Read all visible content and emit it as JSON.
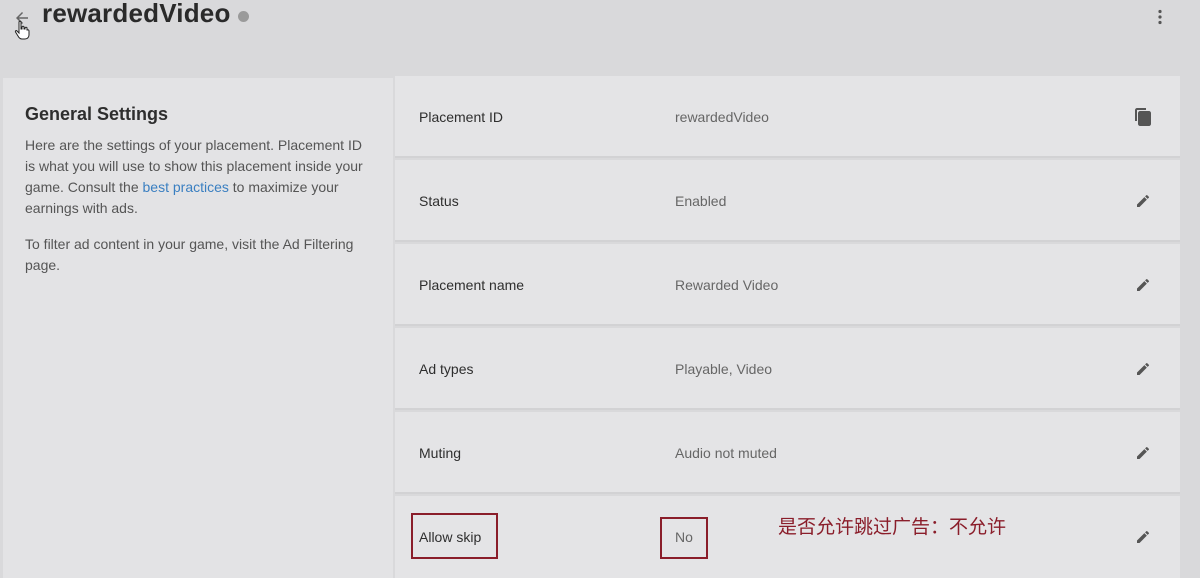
{
  "header": {
    "title": "rewardedVideo",
    "back_icon": "arrow-left-icon",
    "more_icon": "more-vertical-icon",
    "status_color": "#9a9a9a"
  },
  "general": {
    "title": "General Settings",
    "desc_part1": "Here are the settings of your placement. Placement ID is what you will use to show this placement inside your game. Consult the ",
    "desc_link": "best practices",
    "desc_part2": " to maximize your earnings with ads.",
    "filter_text": "To filter ad content in your game, visit the Ad Filtering page."
  },
  "settings": [
    {
      "label": "Placement ID",
      "value": "rewardedVideo",
      "action": "copy-icon"
    },
    {
      "label": "Status",
      "value": "Enabled",
      "action": "edit-icon"
    },
    {
      "label": "Placement name",
      "value": "Rewarded Video",
      "action": "edit-icon"
    },
    {
      "label": "Ad types",
      "value": "Playable, Video",
      "action": "edit-icon"
    },
    {
      "label": "Muting",
      "value": "Audio not muted",
      "action": "edit-icon"
    },
    {
      "label": "Allow skip",
      "value": "No",
      "action": "edit-icon"
    }
  ],
  "annotation": {
    "text": "是否允许跳过广告：不允许",
    "color": "#8a1d2a"
  },
  "colors": {
    "background": "#d9d9db",
    "panel": "#e4e4e6",
    "link": "#3a7fc1"
  }
}
